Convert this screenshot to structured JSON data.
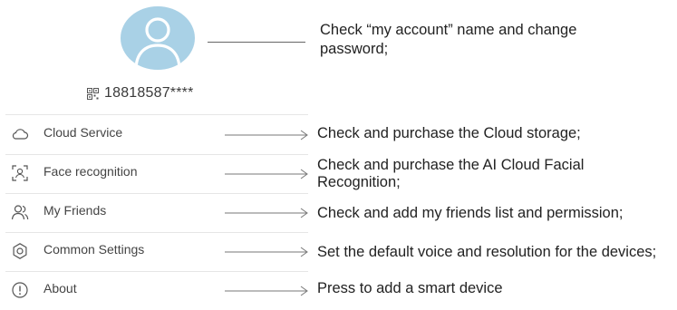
{
  "profile": {
    "account_number": "18818587****",
    "account_description": "Check “my account” name and change password;"
  },
  "menu": [
    {
      "label": "Cloud Service",
      "icon": "cloud-icon",
      "description": "Check and purchase the Cloud storage;"
    },
    {
      "label": "Face recognition",
      "icon": "face-scan-icon",
      "description": "Check and purchase the AI Cloud Facial Recognition;"
    },
    {
      "label": "My Friends",
      "icon": "friends-icon",
      "description": "Check and add my friends list and permission;"
    },
    {
      "label": "Common Settings",
      "icon": "gear-icon",
      "description": "Set the default voice and resolution for the devices;"
    },
    {
      "label": "About",
      "icon": "info-icon",
      "description": "Press to add a smart device"
    }
  ],
  "colors": {
    "avatar_bg": "#a9d1e6",
    "icon_stroke": "#555555",
    "divider": "#e6e6e6"
  }
}
